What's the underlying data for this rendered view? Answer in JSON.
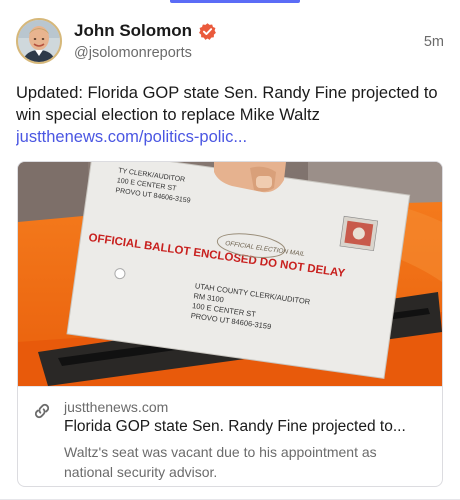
{
  "post": {
    "author_name": "John Solomon",
    "author_handle": "@jsolomonreports",
    "timestamp": "5m",
    "text": "Updated: Florida GOP state Sen. Randy Fine projected to win special election to replace Mike Waltz",
    "link_text": "justthenews.com/politics-polic..."
  },
  "embed": {
    "domain": "justthenews.com",
    "title": "Florida GOP state Sen. Randy Fine projected to...",
    "description": "Waltz's seat was vacant due to his appointment as national security advisor.",
    "image": {
      "envelope_header": "OFFICIAL BALLOT ENCLOSED DO NOT DELAY",
      "stamp_text": "OFFICIAL ELECTION MAIL",
      "address_top": [
        "TY CLERK/AUDITOR",
        "100 E CENTER ST",
        "PROVO UT 84606-3159"
      ],
      "address_bottom": [
        "UTAH COUNTY CLERK/AUDITOR",
        "RM 3100",
        "100 E CENTER ST",
        "PROVO UT 84606-3159"
      ]
    }
  },
  "colors": {
    "accent": "#5b6cf6",
    "link": "#4a56e2",
    "verified": "#ea5a3c",
    "muted_text": "#6b6b6b",
    "envelope_red": "#c8201e",
    "orange_fabric": "#f26a12"
  },
  "icons": {
    "verified": "verified-badge-icon",
    "link": "link-chain-icon"
  }
}
